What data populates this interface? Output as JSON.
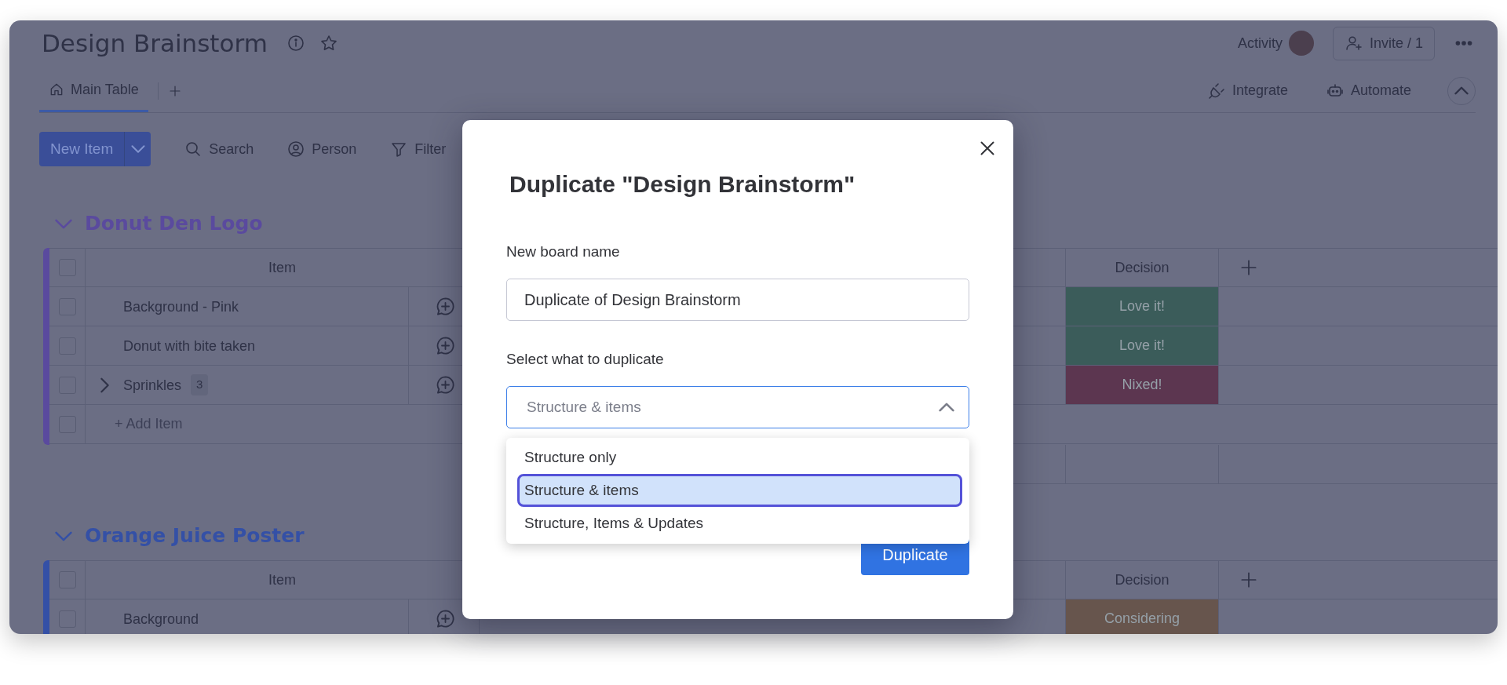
{
  "board": {
    "title": "Design Brainstorm",
    "activity": "Activity",
    "invite": "Invite / 1",
    "views": [
      {
        "label": "Main Table",
        "selected": true
      }
    ],
    "integrations": [
      {
        "kind": "integrate",
        "label": "Integrate"
      },
      {
        "kind": "automate",
        "label": "Automate"
      }
    ],
    "toolbar": {
      "new_item": "New Item",
      "tools": [
        {
          "kind": "search",
          "label": "Search"
        },
        {
          "kind": "person",
          "label": "Person"
        },
        {
          "kind": "filter",
          "label": "Filter"
        }
      ]
    }
  },
  "groups": [
    {
      "title": "Donut Den Logo",
      "color": "#5a4a9e",
      "columns": [
        "Item",
        "Decision"
      ],
      "all_checked": false,
      "rows": [
        {
          "name": "Background - Pink",
          "checked": false,
          "decision": {
            "label": "Love it!",
            "color": "#3b5c5a"
          }
        },
        {
          "name": "Donut with bite taken",
          "checked": false,
          "decision": {
            "label": "Love it!",
            "color": "#3b5c5a"
          }
        },
        {
          "name": "Sprinkles",
          "checked": false,
          "subitems": "3",
          "expanded": false,
          "decision": {
            "label": "Nixed!",
            "color": "#5c3650"
          }
        }
      ],
      "add_item": "+ Add Item"
    },
    {
      "title": "Orange Juice Poster",
      "color": "#3450a6",
      "columns": [
        "Item",
        "Decision"
      ],
      "all_checked": false,
      "rows": [
        {
          "name": "Background",
          "checked": false,
          "decision": {
            "label": "Considering",
            "color": "#67554d"
          }
        }
      ]
    }
  ],
  "modal": {
    "title": "Duplicate \"Design Brainstorm\"",
    "name_label": "New board name",
    "name_value": "Duplicate of Design Brainstorm",
    "select_label": "Select what to duplicate",
    "select_value": "Structure & items",
    "expanded": true,
    "options": [
      {
        "label": "Structure only",
        "selected": false
      },
      {
        "label": "Structure & items",
        "selected": true
      },
      {
        "label": "Structure, Items & Updates",
        "selected": false
      }
    ],
    "button": "Duplicate"
  }
}
